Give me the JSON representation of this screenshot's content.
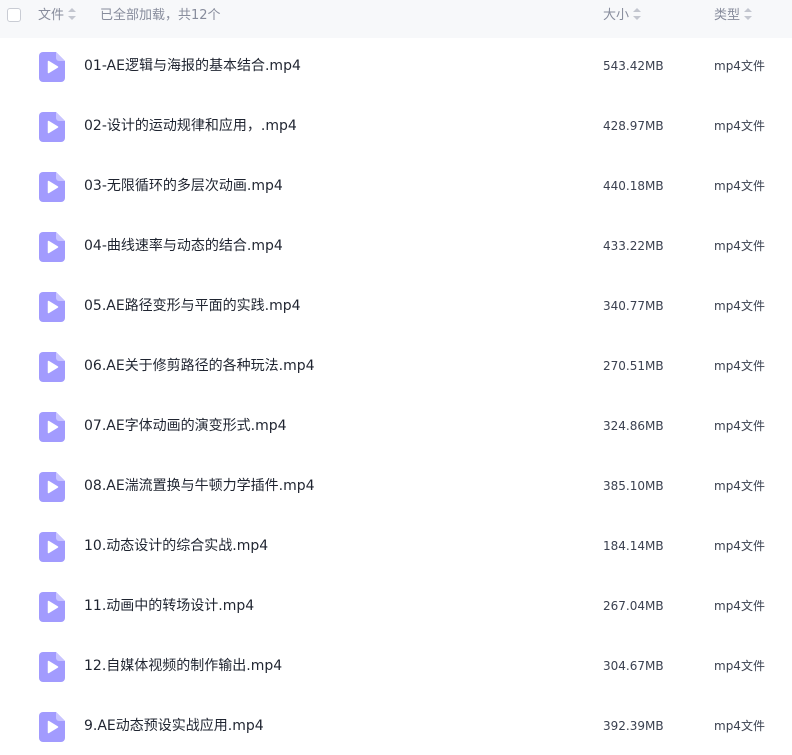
{
  "header": {
    "col_name": "文件",
    "load_status": "已全部加载，共12个",
    "col_size": "大小",
    "col_type": "类型"
  },
  "colors": {
    "icon_bg": "#a29bfe",
    "icon_play": "#ffffff",
    "header_bg": "#f7f8fa"
  },
  "files": [
    {
      "name": "01-AE逻辑与海报的基本结合.mp4",
      "size": "543.42MB",
      "type": "mp4文件",
      "icon": "video-file-icon"
    },
    {
      "name": "02-设计的运动规律和应用，.mp4",
      "size": "428.97MB",
      "type": "mp4文件",
      "icon": "video-file-icon"
    },
    {
      "name": "03-无限循环的多层次动画.mp4",
      "size": "440.18MB",
      "type": "mp4文件",
      "icon": "video-file-icon"
    },
    {
      "name": "04-曲线速率与动态的结合.mp4",
      "size": "433.22MB",
      "type": "mp4文件",
      "icon": "video-file-icon"
    },
    {
      "name": "05.AE路径变形与平面的实践.mp4",
      "size": "340.77MB",
      "type": "mp4文件",
      "icon": "video-file-icon"
    },
    {
      "name": "06.AE关于修剪路径的各种玩法.mp4",
      "size": "270.51MB",
      "type": "mp4文件",
      "icon": "video-file-icon"
    },
    {
      "name": "07.AE字体动画的演变形式.mp4",
      "size": "324.86MB",
      "type": "mp4文件",
      "icon": "video-file-icon"
    },
    {
      "name": "08.AE湍流置换与牛顿力学插件.mp4",
      "size": "385.10MB",
      "type": "mp4文件",
      "icon": "video-file-icon"
    },
    {
      "name": "10.动态设计的综合实战.mp4",
      "size": "184.14MB",
      "type": "mp4文件",
      "icon": "video-file-icon"
    },
    {
      "name": "11.动画中的转场设计.mp4",
      "size": "267.04MB",
      "type": "mp4文件",
      "icon": "video-file-icon"
    },
    {
      "name": "12.自媒体视频的制作输出.mp4",
      "size": "304.67MB",
      "type": "mp4文件",
      "icon": "video-file-icon"
    },
    {
      "name": "9.AE动态预设实战应用.mp4",
      "size": "392.39MB",
      "type": "mp4文件",
      "icon": "video-file-icon"
    }
  ]
}
